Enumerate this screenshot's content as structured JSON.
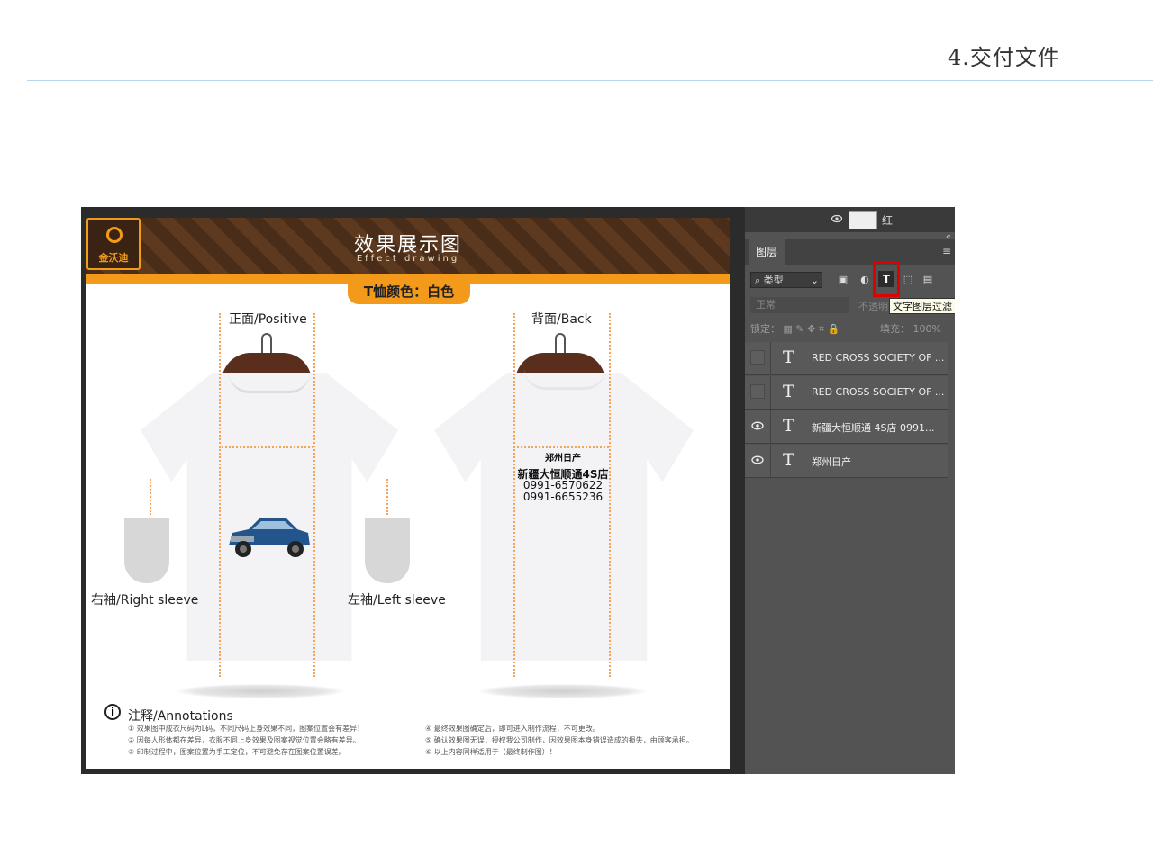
{
  "slide": {
    "title": "4.交付文件"
  },
  "sheet": {
    "logo_text": "金沃迪",
    "banner_title": "效果展示图",
    "banner_subtitle": "Effect drawing",
    "color_tab": "T恤颜色：白色",
    "front_label": "正面/Positive",
    "back_label": "背面/Back",
    "right_sleeve_label": "右袖/Right sleeve",
    "left_sleeve_label": "左袖/Left sleeve",
    "back_print": {
      "line1": "郑州日产",
      "line2": "新疆大恒顺通4S店",
      "line3": "0991-6570622",
      "line4": "0991-6655236"
    },
    "annotations": {
      "title": "注释/Annotations",
      "icon": "i",
      "items": [
        "① 效果图中成衣尺码为L码，不同尺码上身效果不同，图案位置会有差异！",
        "② 因每人形体都在差异，衣服不同上身效果及图案视觉位置会略有差异。",
        "③ 印制过程中，图案位置为手工定位，不可避免存在图案位置误差。",
        "④ 最终效果图确定后，即可进入制作流程，不可更改。",
        "⑤ 确认效果图无误，授权我公司制作，因效果图本身错误造成的损失，由顾客承担。",
        "⑥ 以上内容同样适用于（最终制作图）！"
      ]
    }
  },
  "photoshop": {
    "top_layer_name": "红",
    "panel_tab": "图层",
    "filter_type": "类型",
    "blend_mode": "正常",
    "opacity_label": "不透明",
    "tooltip": "文字图层过滤",
    "lock_label": "锁定：",
    "fill_label": "填充：",
    "fill_value": "100%",
    "layers": [
      {
        "name": "RED CROSS SOCIETY OF ...",
        "visible": false
      },
      {
        "name": "RED CROSS SOCIETY OF ...",
        "visible": false
      },
      {
        "name": "新疆大恒顺通 4S店 0991...",
        "visible": true
      },
      {
        "name": "郑州日产",
        "visible": true
      }
    ],
    "colors": {
      "panel_bg": "#535353",
      "active_filter_border": "#e10000"
    }
  }
}
